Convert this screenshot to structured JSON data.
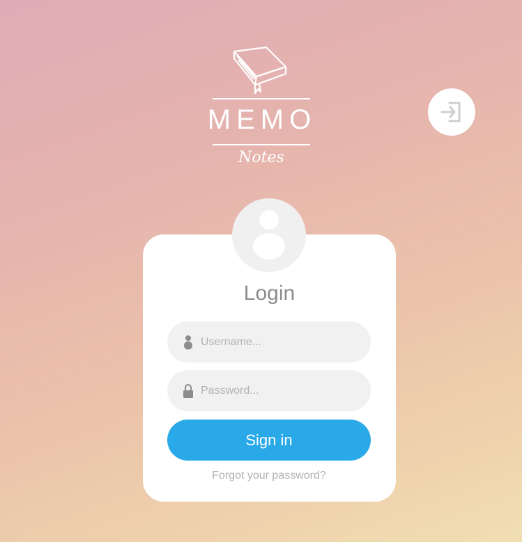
{
  "header": {
    "brand": "MEMO",
    "sub_brand": "Notes",
    "logo_icon": "book-icon",
    "logout_icon": "sign-in-arrow-icon"
  },
  "login": {
    "title": "Login",
    "avatar_icon": "user-avatar-icon",
    "username": {
      "placeholder": "Username...",
      "value": "",
      "icon": "user-icon"
    },
    "password": {
      "placeholder": "Password...",
      "value": "",
      "icon": "lock-icon"
    },
    "submit_label": "Sign in",
    "forgot_label": "Forgot your password?"
  },
  "colors": {
    "accent": "#29a9e8",
    "field_bg": "#f1f1f1",
    "muted_text": "#b2b2b2",
    "title_text": "#8c8c8c"
  }
}
